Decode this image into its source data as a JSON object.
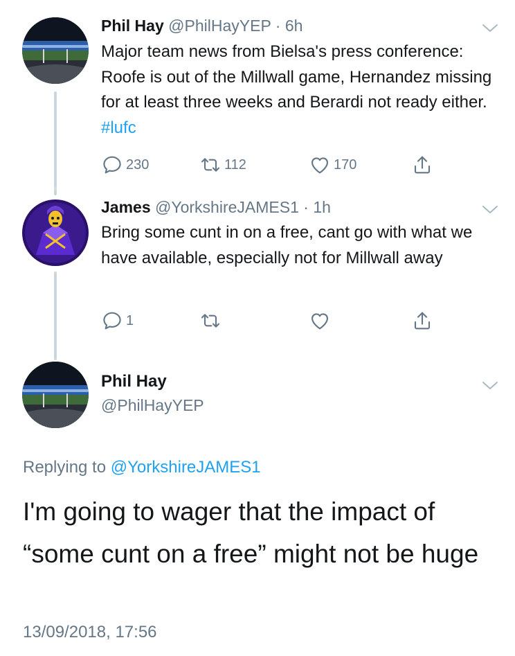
{
  "tweet1": {
    "name": "Phil Hay",
    "handle": "@PhilHayYEP",
    "separator": "·",
    "time": "6h",
    "text": "Major team news from Bielsa's press conference: Roofe is out of the Millwall game, Hernandez missing for at least three weeks and Berardi not ready either.",
    "hashtag": "#lufc",
    "replies": "230",
    "retweets": "112",
    "likes": "170"
  },
  "tweet2": {
    "name": "James",
    "handle": "@YorkshireJAMES1",
    "separator": "·",
    "time": "1h",
    "text": "Bring some cunt in on a free, cant go with what we have available, especially not for Millwall away",
    "replies": "1",
    "retweets": "",
    "likes": ""
  },
  "main_tweet": {
    "name": "Phil Hay",
    "handle": "@PhilHayYEP",
    "replying_prefix": "Replying to",
    "replying_to": "@YorkshireJAMES1",
    "text": "I'm going to wager that the impact of “some cunt on a free” might not be huge",
    "timestamp": "13/09/2018, 17:56"
  },
  "icons": {
    "reply": "reply-icon",
    "retweet": "retweet-icon",
    "like": "heart-icon",
    "share": "share-icon",
    "more": "chevron-down-icon"
  },
  "colors": {
    "link": "#1da1f2",
    "secondary": "#657786",
    "thread_line": "#ccd6dd"
  }
}
